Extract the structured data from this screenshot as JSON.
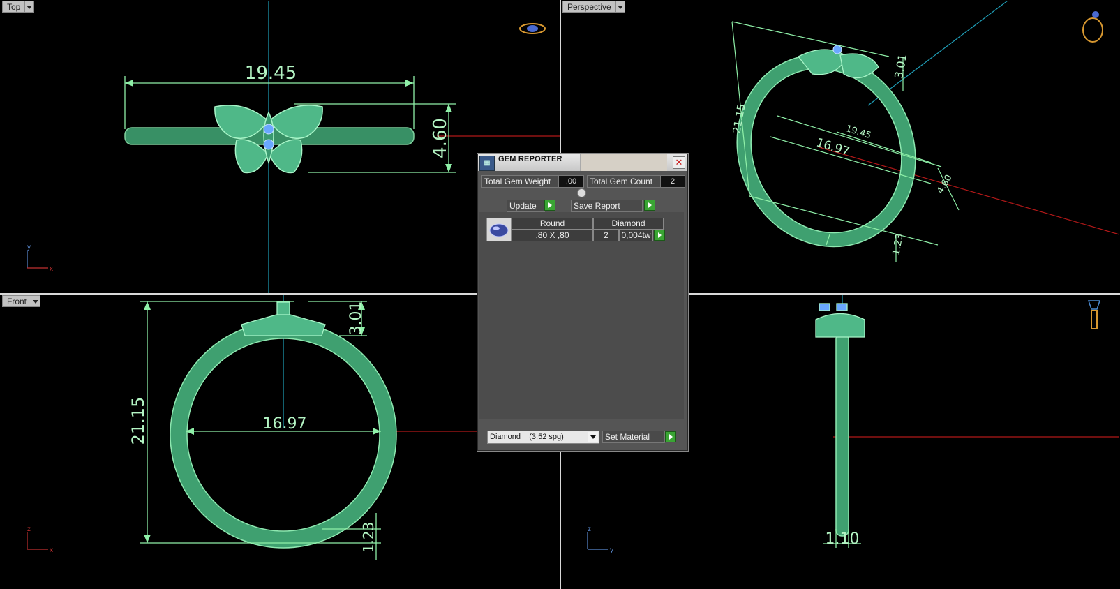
{
  "viewports": {
    "top": {
      "label": "Top",
      "dims": {
        "width": "19.45",
        "height": "4.60"
      },
      "axes": {
        "a": "y",
        "b": "x"
      }
    },
    "perspective": {
      "label": "Perspective",
      "dims": {
        "outer": "21.15",
        "top": "3.01",
        "width": "19.45",
        "inner": "16.97",
        "height": "4.60",
        "band": "1.23"
      }
    },
    "front": {
      "label": "Front",
      "dims": {
        "outer": "21.15",
        "top": "3.01",
        "inner": "16.97",
        "band": "1.23"
      },
      "axes": {
        "a": "z",
        "b": "x"
      }
    },
    "right": {
      "dims": {
        "thickness": "1.10"
      },
      "axes": {
        "a": "z",
        "b": "y"
      }
    }
  },
  "gem_reporter": {
    "title": "GEM REPORTER",
    "total_weight_label": "Total Gem Weight",
    "total_weight_value": ",00",
    "total_count_label": "Total Gem Count",
    "total_count_value": "2",
    "update_label": "Update",
    "save_label": "Save Report",
    "table": {
      "headers": [
        "Round",
        "Diamond"
      ],
      "rows": [
        {
          "size": ",80 X ,80",
          "count": "2",
          "weight": "0,004tw"
        }
      ]
    },
    "material_value": "Diamond    (3,52 spg)",
    "set_material_label": "Set Material"
  },
  "colors": {
    "model_green": "#5cc58f",
    "dimension_green": "#8ff0a8",
    "axis_red": "#b01818",
    "axis_cyan": "#1f9fb8",
    "apply_green": "#3aa534"
  }
}
